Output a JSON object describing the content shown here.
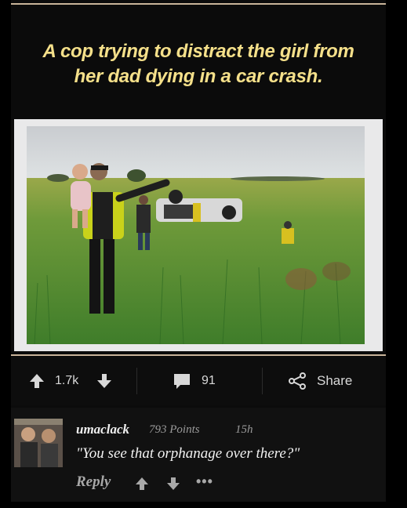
{
  "post": {
    "title_line1": "A cop trying to distract the girl from",
    "title_line2": "her dad dying in a car crash."
  },
  "actions": {
    "upvotes": "1.7k",
    "comments": "91",
    "share_label": "Share"
  },
  "comment": {
    "username": "umaclack",
    "points": "793 Points",
    "time": "15h",
    "text": "\"You see that orphanage over there?\"",
    "reply_label": "Reply",
    "more": "•••"
  },
  "icons": {
    "upvote": "arrow-up-icon",
    "downvote": "arrow-down-icon",
    "comments": "speech-bubble-icon",
    "share": "share-icon",
    "more": "more-dots-icon"
  },
  "colors": {
    "title": "#f5e08a",
    "background": "#000000",
    "accent_border": "#c9b49a"
  }
}
